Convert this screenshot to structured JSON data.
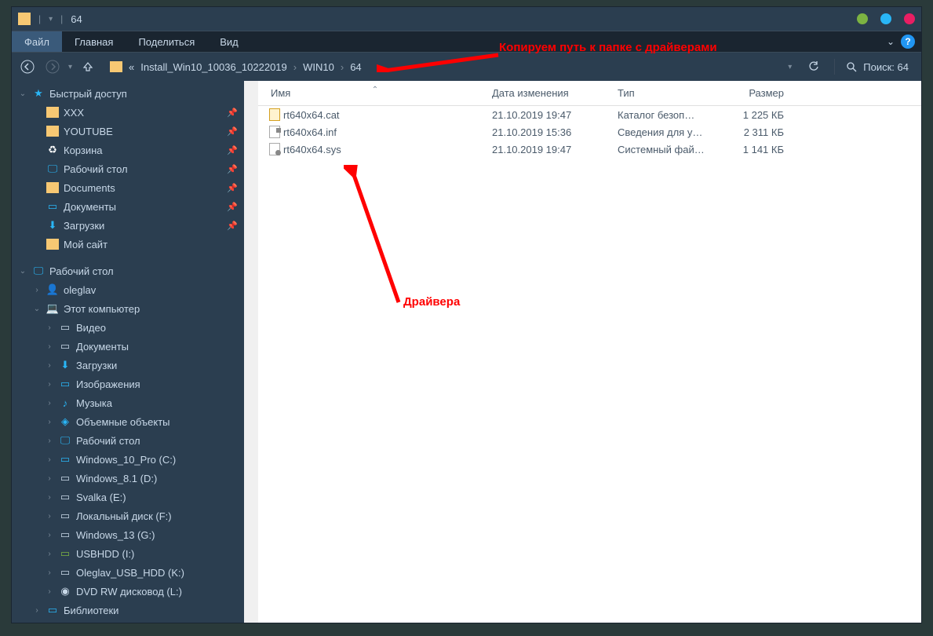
{
  "titlebar": {
    "title": "64"
  },
  "ribbon": {
    "tabs": [
      "Файл",
      "Главная",
      "Поделиться",
      "Вид"
    ]
  },
  "breadcrumb": {
    "prefix": "«",
    "segments": [
      "Install_Win10_10036_10222019",
      "WIN10",
      "64"
    ]
  },
  "search": {
    "label": "Поиск: 64"
  },
  "sidebar": {
    "quickAccess": {
      "label": "Быстрый доступ",
      "items": [
        {
          "label": "XXX",
          "icon": "folder",
          "pinned": true
        },
        {
          "label": "YOUTUBE",
          "icon": "folder",
          "pinned": true
        },
        {
          "label": "Корзина",
          "icon": "recycle",
          "pinned": true
        },
        {
          "label": "Рабочий стол",
          "icon": "desktop",
          "pinned": true
        },
        {
          "label": "Documents",
          "icon": "folder",
          "pinned": true
        },
        {
          "label": "Документы",
          "icon": "spec",
          "pinned": true
        },
        {
          "label": "Загрузки",
          "icon": "download",
          "pinned": true
        },
        {
          "label": "Мой сайт",
          "icon": "folder",
          "pinned": false
        }
      ]
    },
    "desktop": {
      "label": "Рабочий стол",
      "items": [
        {
          "label": "oleglav",
          "icon": "user",
          "chev": ">"
        },
        {
          "label": "Этот компьютер",
          "icon": "pc",
          "chev": "v",
          "children": [
            {
              "label": "Видео",
              "icon": "video",
              "chev": ">"
            },
            {
              "label": "Документы",
              "icon": "doc",
              "chev": ">"
            },
            {
              "label": "Загрузки",
              "icon": "download",
              "chev": ">"
            },
            {
              "label": "Изображения",
              "icon": "img",
              "chev": ">"
            },
            {
              "label": "Музыка",
              "icon": "music",
              "chev": ">"
            },
            {
              "label": "Объемные объекты",
              "icon": "obj",
              "chev": ">"
            },
            {
              "label": "Рабочий стол",
              "icon": "desktop",
              "chev": ">"
            },
            {
              "label": "Windows_10_Pro (C:)",
              "icon": "drive-win",
              "chev": ">"
            },
            {
              "label": "Windows_8.1 (D:)",
              "icon": "drive",
              "chev": ">"
            },
            {
              "label": "Svalka (E:)",
              "icon": "drive",
              "chev": ">"
            },
            {
              "label": "Локальный диск (F:)",
              "icon": "drive",
              "chev": ">"
            },
            {
              "label": "Windows_13 (G:)",
              "icon": "drive",
              "chev": ">"
            },
            {
              "label": "USBHDD (I:)",
              "icon": "usb",
              "chev": ">"
            },
            {
              "label": "Oleglav_USB_HDD (K:)",
              "icon": "drive",
              "chev": ">"
            },
            {
              "label": "DVD RW дисковод (L:)",
              "icon": "dvd",
              "chev": ">"
            }
          ]
        },
        {
          "label": "Библиотеки",
          "icon": "lib",
          "chev": ">"
        }
      ]
    }
  },
  "columns": {
    "name": "Имя",
    "date": "Дата изменения",
    "type": "Тип",
    "size": "Размер"
  },
  "files": [
    {
      "name": "rt640x64.cat",
      "date": "21.10.2019 19:47",
      "type": "Каталог безоп…",
      "size": "1 225 КБ",
      "icon": "cat"
    },
    {
      "name": "rt640x64.inf",
      "date": "21.10.2019 15:36",
      "type": "Сведения для у…",
      "size": "2 311 КБ",
      "icon": "inf"
    },
    {
      "name": "rt640x64.sys",
      "date": "21.10.2019 19:47",
      "type": "Системный фай…",
      "size": "1 141 КБ",
      "icon": "sys"
    }
  ],
  "annotations": {
    "top": "Копируем путь к папке с драйверами",
    "bottom": "Драйвера"
  }
}
